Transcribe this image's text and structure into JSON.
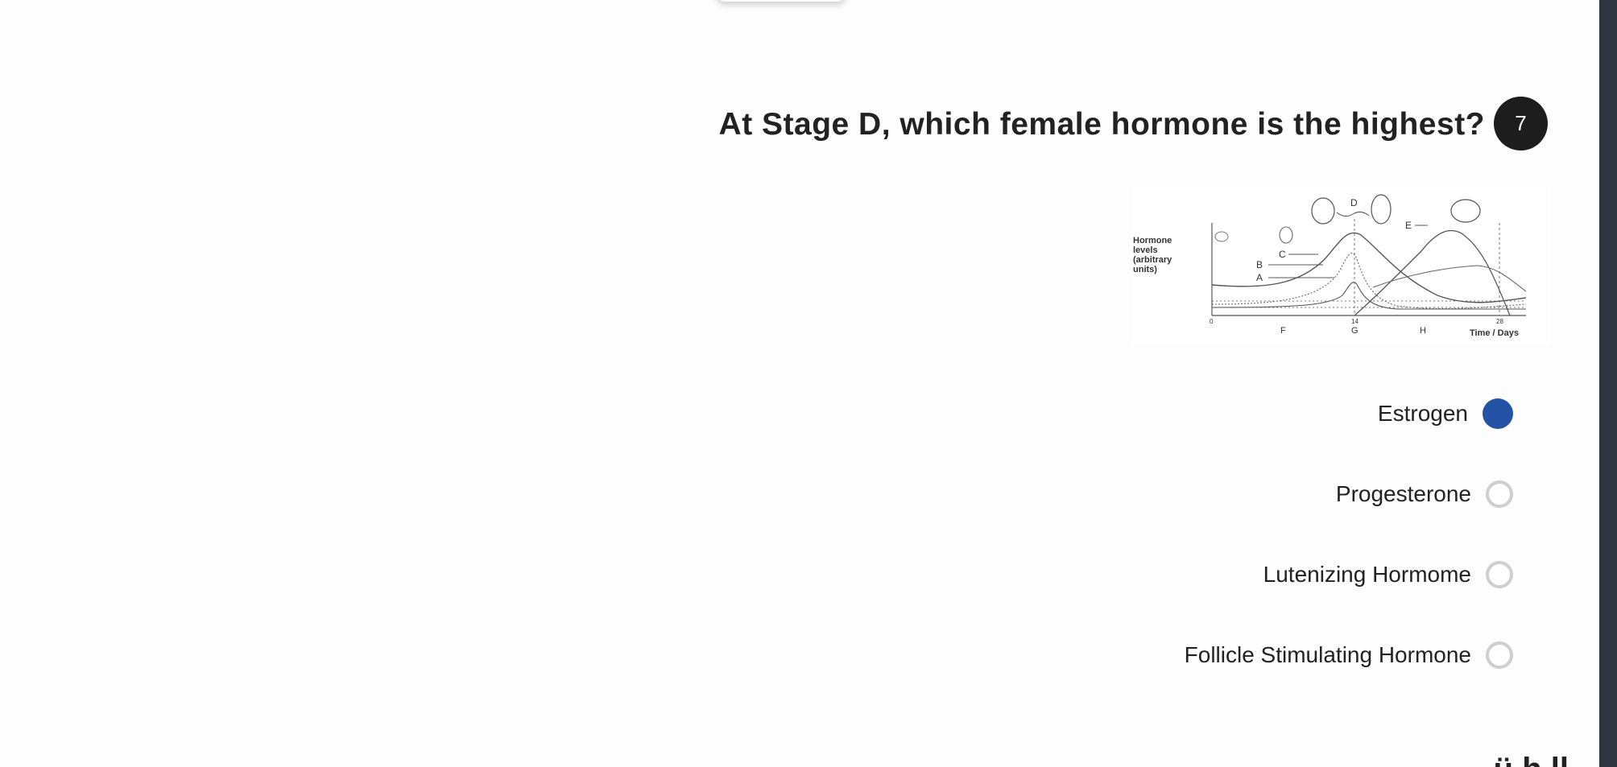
{
  "question": {
    "number": "7",
    "title": "At Stage D, which female hormone is the highest?"
  },
  "figure": {
    "y_label_lines": [
      "Hormone",
      "levels",
      "(arbitrary",
      "units)"
    ],
    "curve_labels": [
      "C",
      "B",
      "A",
      "D",
      "E"
    ],
    "x_ticks": [
      "0",
      "14",
      "28"
    ],
    "phase_labels": [
      "F",
      "G",
      "H"
    ],
    "x_axis_label": "Time / Days"
  },
  "options": [
    {
      "label": "Estrogen",
      "selected": true
    },
    {
      "label": "Progesterone",
      "selected": false
    },
    {
      "label": "Lutenizing Hormome",
      "selected": false
    },
    {
      "label": "Follicle Stimulating Hormone",
      "selected": false
    }
  ],
  "next_question_fragment": "ü h ll",
  "colors": {
    "selected_radio": "#2453a6",
    "badge_bg": "#1d1d1d",
    "scroll_rail": "#2f3640"
  }
}
